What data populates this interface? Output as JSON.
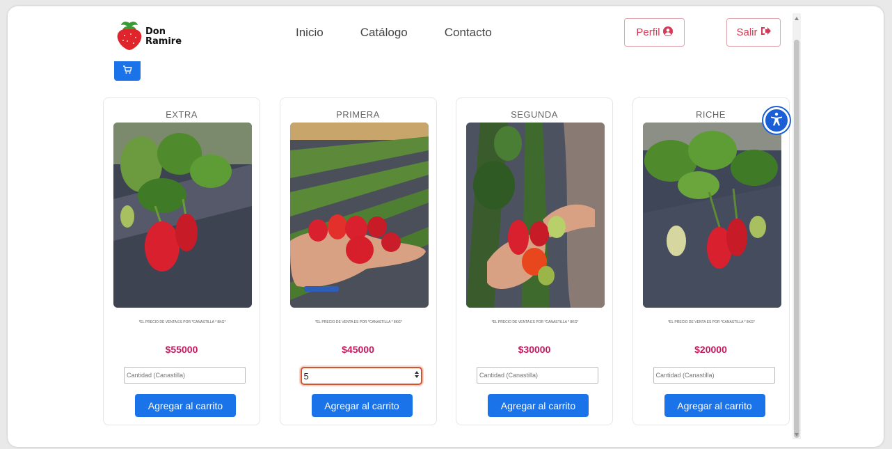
{
  "brand": {
    "name_line1": "Don",
    "name_line2": "Ramire",
    "accent": "#d33a55"
  },
  "nav": {
    "links": [
      {
        "label": "Inicio"
      },
      {
        "label": "Catálogo"
      },
      {
        "label": "Contacto"
      }
    ],
    "perfil_label": "Perfil",
    "salir_label": "Salir"
  },
  "icons": {
    "logo": "strawberry-icon",
    "cart": "cart-icon",
    "accessibility": "accessibility-icon",
    "perfil": "user-circle-icon",
    "salir": "sign-out-icon"
  },
  "products": [
    {
      "title": "EXTRA",
      "note": "*EL PRECIO DE VENTA ES POR *CANASTILLA * 8KG*",
      "price": "$55000",
      "qty_value": "",
      "qty_placeholder": "Cantidad (Canastilla)",
      "add_label": "Agregar al carrito"
    },
    {
      "title": "PRIMERA",
      "note": "*EL PRECIO DE VENTA ES POR *CANASTILLA * 8KG*",
      "price": "$45000",
      "qty_value": "5",
      "qty_placeholder": "Cantidad (Canastilla)",
      "add_label": "Agregar al carrito"
    },
    {
      "title": "SEGUNDA",
      "note": "*EL PRECIO DE VENTA ES POR *CANASTILLA * 8KG*",
      "price": "$30000",
      "qty_value": "",
      "qty_placeholder": "Cantidad (Canastilla)",
      "add_label": "Agregar al carrito"
    },
    {
      "title": "RICHE",
      "note": "*EL PRECIO DE VENTA ES POR *CANASTILLA * 8KG*",
      "price": "$20000",
      "qty_value": "",
      "qty_placeholder": "Cantidad (Canastilla)",
      "add_label": "Agregar al carrito"
    }
  ]
}
